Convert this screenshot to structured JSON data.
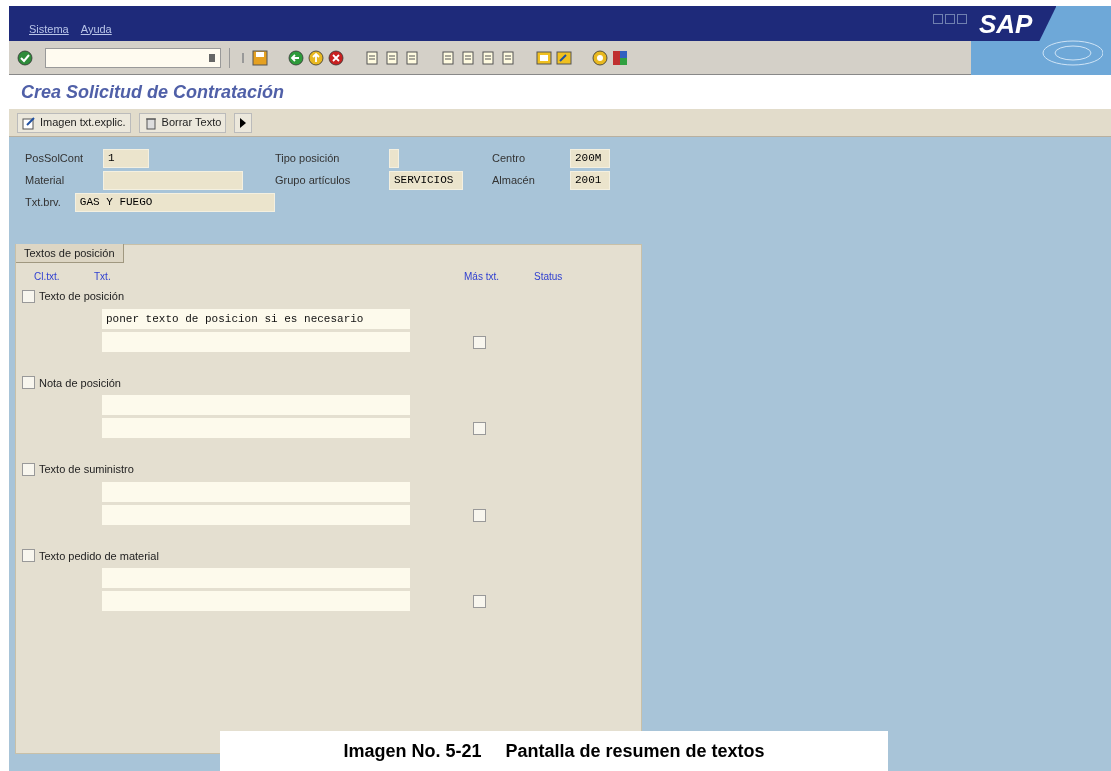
{
  "window": {
    "menu": [
      "Sistema",
      "Ayuda"
    ],
    "logo": "SAP"
  },
  "title": "Crea Solicitud de Contratación",
  "app_toolbar": [
    {
      "kind": "edit",
      "label": "Imagen txt.explic."
    },
    {
      "kind": "delete",
      "label": "Borrar Texto"
    },
    {
      "kind": "more"
    }
  ],
  "fields": [
    [
      {
        "label": "PosSolCont",
        "value": "1"
      },
      {
        "label": "Tipo posición"
      },
      {
        "label": "Centro",
        "value": "200M"
      }
    ],
    [
      {
        "label": "Material"
      },
      {
        "label": "Grupo artículos",
        "value": "SERVICIOS"
      },
      {
        "label": "Almacén",
        "value": "2001"
      }
    ],
    [
      {
        "label": "Txt.brv.",
        "value": "GAS Y FUEGO"
      }
    ]
  ],
  "texts_group": {
    "tab": "Textos de posición",
    "columns": [
      "Cl.txt.",
      "Txt.",
      "Más txt.",
      "Status"
    ],
    "rows": [
      {
        "label": "Texto de posición",
        "checked": false,
        "more_text": false,
        "lines": [
          "poner texto de posicion si es necesario"
        ]
      },
      {
        "label": "Nota de posición",
        "checked": false,
        "more_text": false
      },
      {
        "label": "Texto de suministro",
        "checked": false,
        "more_text": false
      },
      {
        "label": "Texto pedido de material",
        "checked": false,
        "more_text": false
      }
    ]
  },
  "caption": {
    "number": "Imagen No. 5-21",
    "text": "Pantalla de resumen de textos"
  }
}
